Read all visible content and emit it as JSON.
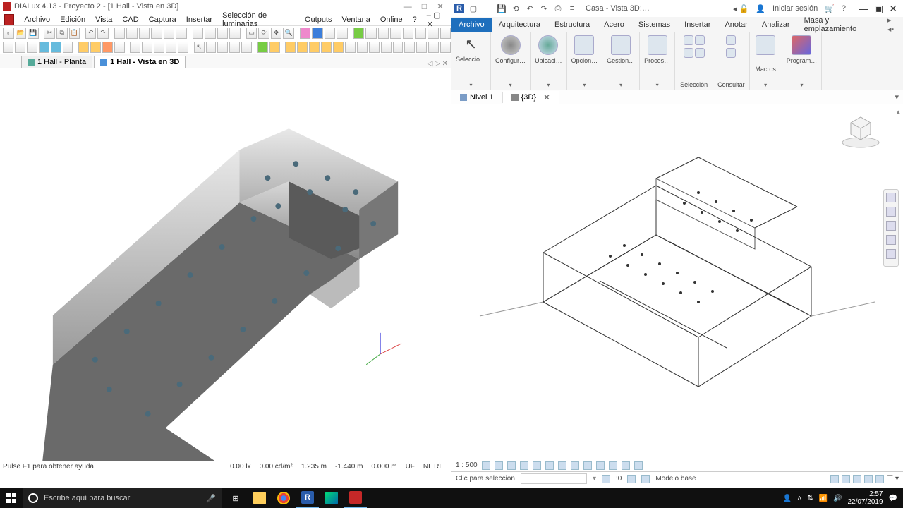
{
  "dialux": {
    "title": "DIALux 4.13 - Proyecto 2 - [1 Hall - Vista en 3D]",
    "menu": [
      "Archivo",
      "Edición",
      "Vista",
      "CAD",
      "Captura",
      "Insertar",
      "Selección de luminarias",
      "Outputs",
      "Ventana",
      "Online",
      "?"
    ],
    "tabs": [
      {
        "label": "1 Hall - Planta",
        "active": false
      },
      {
        "label": "1 Hall - Vista en 3D",
        "active": true
      }
    ],
    "status": {
      "help": "Pulse F1 para obtener ayuda.",
      "lux": "0.00 lx",
      "cdm2": "0.00 cd/m²",
      "x": "1.235 m",
      "y": "-1.440 m",
      "z": "0.000 m",
      "uf": "UF",
      "nlre": "NL RE"
    }
  },
  "revit": {
    "qat_doc": "Casa - Vista 3D:…",
    "signin": "Iniciar sesión",
    "ribbon_tabs": [
      "Archivo",
      "Arquitectura",
      "Estructura",
      "Acero",
      "Sistemas",
      "Insertar",
      "Anotar",
      "Analizar",
      "Masa y emplazamiento"
    ],
    "groups": [
      {
        "label": "Seleccio…",
        "icon": "cursor"
      },
      {
        "label": "Configur…",
        "icon": "globe"
      },
      {
        "label": "Ubicaci…",
        "icon": "globe2"
      },
      {
        "label": "Opcion…",
        "icon": "doc"
      },
      {
        "label": "Gestion…",
        "icon": "doc2"
      },
      {
        "label": "Proces…",
        "icon": "grid"
      }
    ],
    "panels": [
      "Selección",
      "Consultar",
      "Macros"
    ],
    "program": "Program…",
    "view_tabs": [
      {
        "label": "Nivel 1",
        "active": false,
        "close": false
      },
      {
        "label": "{3D}",
        "active": true,
        "close": true
      }
    ],
    "scale": "1 : 500",
    "status_prompt": "Clic para seleccion",
    "status_zero": ":0",
    "status_model": "Modelo base"
  },
  "taskbar": {
    "search_placeholder": "Escribe aquí para buscar",
    "time": "2:57",
    "date": "22/07/2019"
  }
}
